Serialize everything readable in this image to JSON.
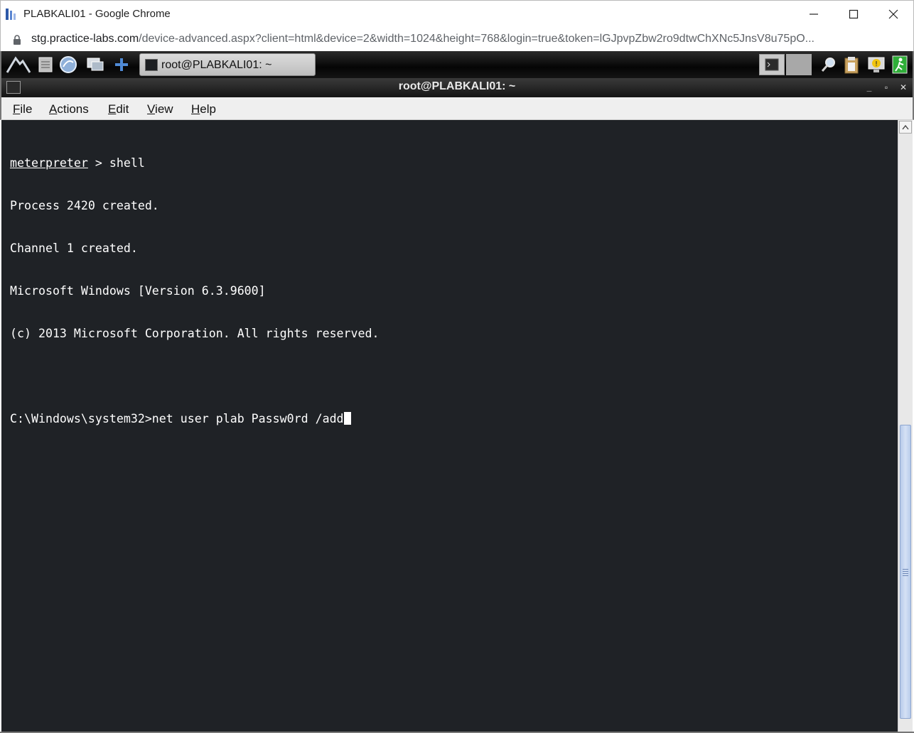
{
  "browser": {
    "window_title": "PLABKALI01 - Google Chrome",
    "url_host": "stg.practice-labs.com",
    "url_rest": "/device-advanced.aspx?client=html&device=2&width=1024&height=768&login=true&token=lGJpvpZbw2ro9dtwChXNc5JnsV8u75pO...",
    "controls": {
      "minimize": "minimize-icon",
      "maximize": "maximize-icon",
      "close": "close-icon"
    }
  },
  "taskbar": {
    "launchers": [
      "kali-menu-icon",
      "file-manager-icon",
      "browser-icon",
      "show-desktop-icon",
      "add-icon"
    ],
    "task_label": "root@PLABKALI01: ~",
    "tray": [
      "terminal-tray-icon",
      "search-tray-icon",
      "clipboard-tray-icon",
      "alert-tray-icon",
      "logout-tray-icon"
    ]
  },
  "terminal_window": {
    "title": "root@PLABKALI01: ~",
    "controls": [
      "_",
      "▫",
      "✕"
    ]
  },
  "menu": {
    "items": [
      {
        "mnemonic": "F",
        "rest": "ile"
      },
      {
        "mnemonic": "A",
        "rest": "ctions"
      },
      {
        "mnemonic": "E",
        "rest": "dit"
      },
      {
        "mnemonic": "V",
        "rest": "iew"
      },
      {
        "mnemonic": "H",
        "rest": "elp"
      }
    ]
  },
  "terminal": {
    "prompt_prefix": "meterpreter",
    "prompt_rest": " > shell",
    "lines": [
      "Process 2420 created.",
      "Channel 1 created.",
      "Microsoft Windows [Version 6.3.9600]",
      "(c) 2013 Microsoft Corporation. All rights reserved.",
      ""
    ],
    "current_command": "C:\\Windows\\system32>net user plab Passw0rd /add"
  },
  "colors": {
    "terminal_bg": "#1f2226",
    "terminal_fg": "#ffffff",
    "menubar_bg": "#efefef",
    "scroll_thumb": "#c6d6f0"
  }
}
